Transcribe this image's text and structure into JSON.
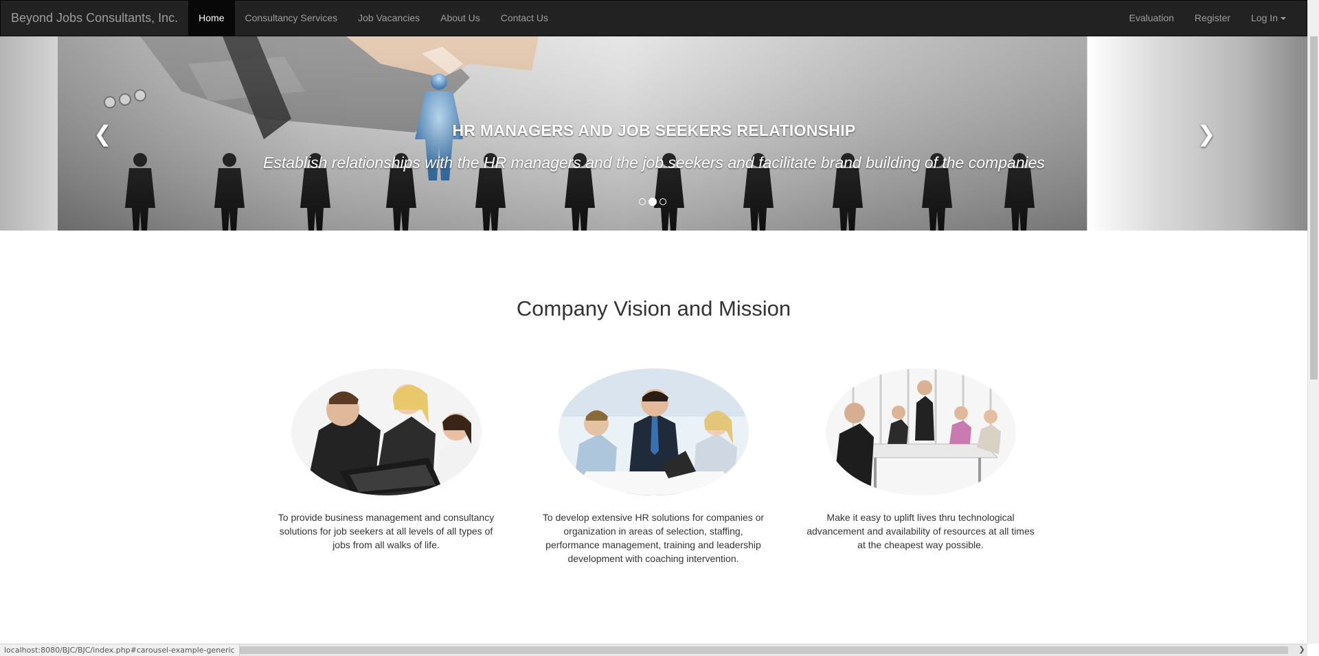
{
  "navbar": {
    "brand": "Beyond Jobs Consultants, Inc.",
    "left_items": [
      {
        "label": "Home",
        "active": true
      },
      {
        "label": "Consultancy Services"
      },
      {
        "label": "Job Vacancies"
      },
      {
        "label": "About Us"
      },
      {
        "label": "Contact Us"
      }
    ],
    "right_items": [
      {
        "label": "Evaluation"
      },
      {
        "label": "Register"
      },
      {
        "label": "Log In"
      }
    ]
  },
  "carousel": {
    "heading": "HR MANAGERS AND JOB SEEKERS RELATIONSHIP",
    "text": "Establish relationships with the HR managers and the job seekers and facilitate brand building of the companies",
    "prev_icon": "chevron-left-icon",
    "next_icon": "chevron-right-icon",
    "slide_count": 3,
    "active_slide": 2
  },
  "main": {
    "title": "Company Vision and Mission",
    "columns": [
      {
        "text": "To provide business management and consultancy solutions for job seekers at all levels of all types of jobs from all walks of life."
      },
      {
        "text": "To develop extensive HR solutions for companies or organization in areas of selection, staffing, performance management, training and leadership development with coaching intervention."
      },
      {
        "text": "Make it easy to uplift lives thru technological advancement and availability of resources at all times at the cheapest way possible."
      }
    ]
  },
  "status_bar": {
    "url": "localhost:8080/BJC/BJC/index.php#carousel-example-generic"
  }
}
